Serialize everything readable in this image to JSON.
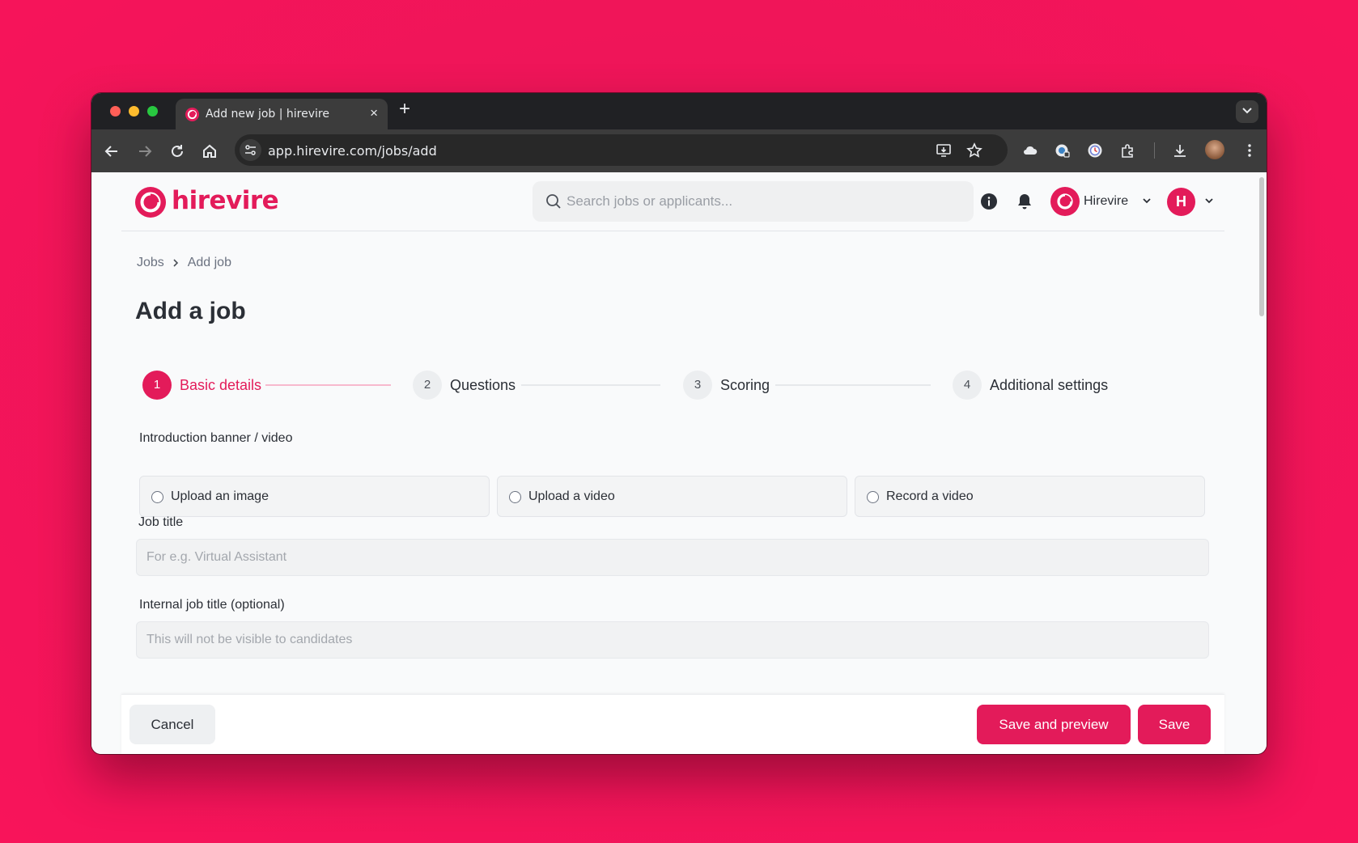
{
  "browser": {
    "tab_title": "Add new job | hirevire",
    "tab_close": "×",
    "new_tab": "+",
    "url": "app.hirevire.com/jobs/add"
  },
  "header": {
    "logo_text": "hirevire",
    "search_placeholder": "Search jobs or applicants...",
    "org_name": "Hirevire",
    "user_initial": "H"
  },
  "breadcrumb": {
    "items": [
      "Jobs",
      "Add job"
    ]
  },
  "page_title": "Add a job",
  "stepper": {
    "steps": [
      {
        "number": "1",
        "label": "Basic details",
        "active": true
      },
      {
        "number": "2",
        "label": "Questions",
        "active": false
      },
      {
        "number": "3",
        "label": "Scoring",
        "active": false
      },
      {
        "number": "4",
        "label": "Additional settings",
        "active": false
      }
    ]
  },
  "form": {
    "intro_label": "Introduction banner / video",
    "intro_options": [
      "Upload an image",
      "Upload a video",
      "Record a video"
    ],
    "job_title_label": "Job title",
    "job_title_placeholder": "For e.g. Virtual Assistant",
    "job_title_value": "",
    "internal_title_label": "Internal job title (optional)",
    "internal_title_placeholder": "This will not be visible to candidates",
    "internal_title_value": ""
  },
  "footer": {
    "cancel_label": "Cancel",
    "save_preview_label": "Save and preview",
    "save_label": "Save"
  },
  "colors": {
    "brand": "#e31b5a",
    "background": "#f8145a"
  }
}
